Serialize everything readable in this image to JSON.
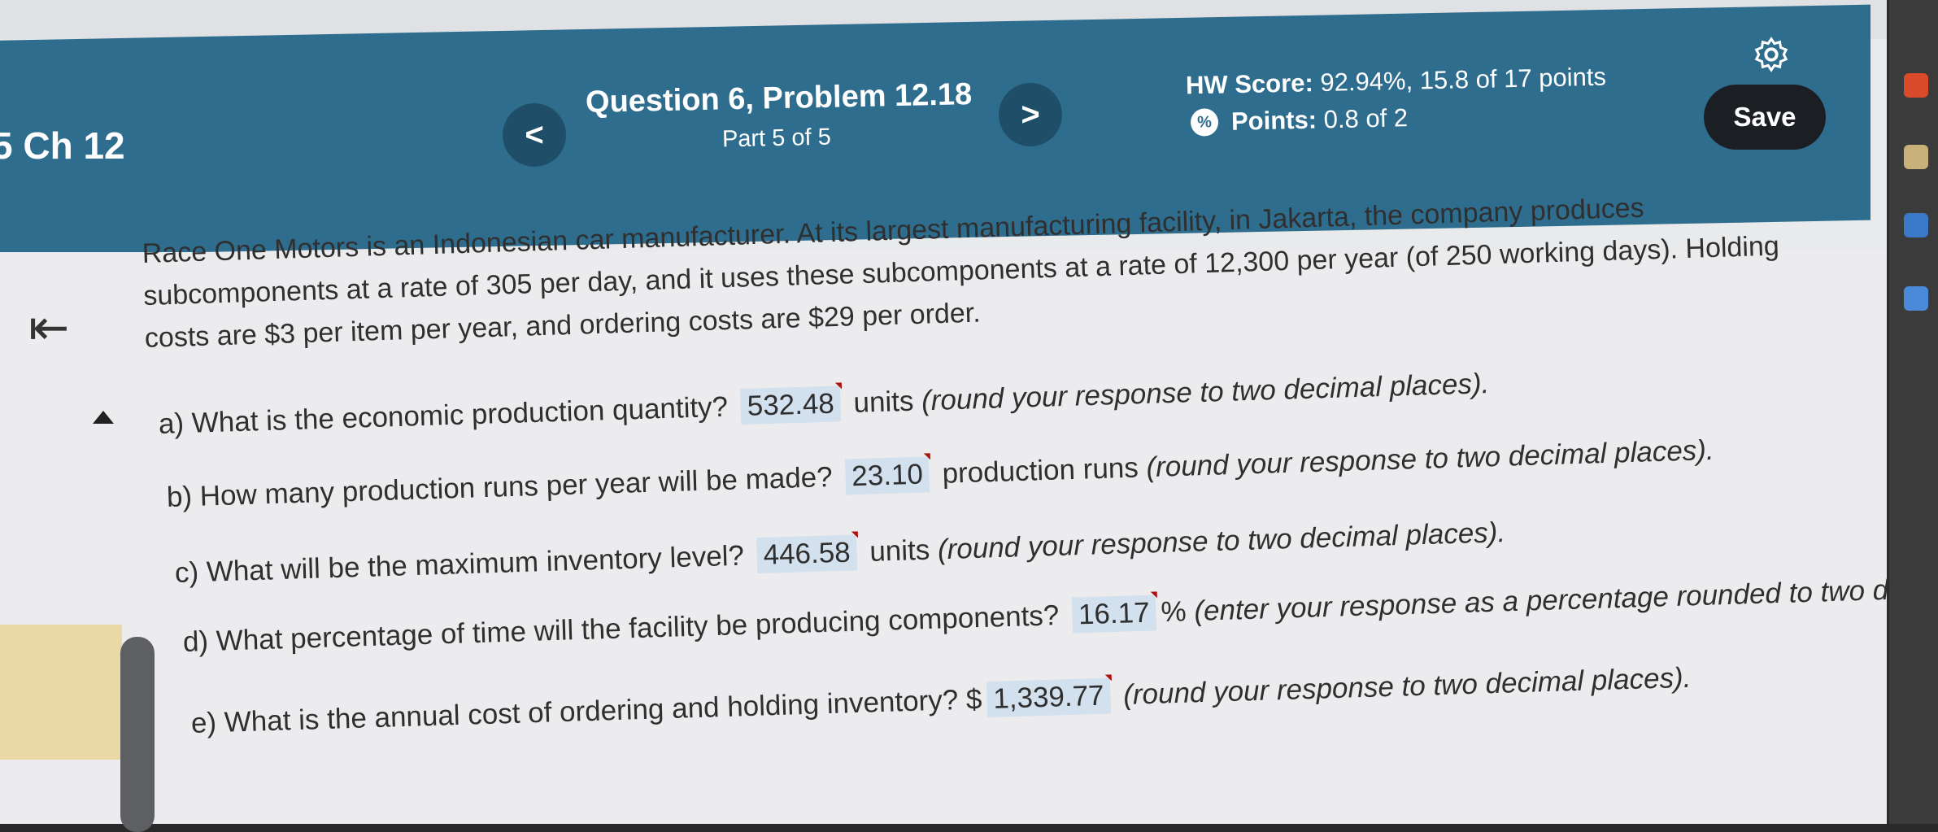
{
  "course": {
    "title": "5 Ch 12"
  },
  "question": {
    "title": "Question 6, Problem 12.18",
    "part": "Part 5 of 5",
    "prev_label": "<",
    "next_label": ">"
  },
  "score": {
    "hw_label": "HW Score:",
    "hw_value": "92.94%, 15.8 of 17 points",
    "points_label": "Points:",
    "points_value": "0.8 of 2"
  },
  "toolbar": {
    "save_label": "Save"
  },
  "problem_text": "Race One Motors is an Indonesian car manufacturer. At its largest manufacturing facility, in Jakarta, the company produces subcomponents at a rate of 305 per day, and it uses these subcomponents at a rate of 12,300 per year (of 250 working days). Holding costs are $3 per item per year, and ordering costs are $29 per order.",
  "parts": [
    {
      "prompt": "a) What is the economic production quantity?",
      "answer": "532.48",
      "after": "units",
      "note": "(round your response to two decimal places)."
    },
    {
      "prompt": "b) How many production runs per year will be made?",
      "answer": "23.10",
      "after": "production runs",
      "note": "(round your response to two decimal places)."
    },
    {
      "prompt": "c) What will be the maximum inventory level?",
      "answer": "446.58",
      "after": "units",
      "note": "(round your response to two decimal places)."
    },
    {
      "prompt": "d) What percentage of time will the facility be producing components?",
      "answer": "16.17",
      "after": "%",
      "note": "(enter your response as a percentage rounded to two decimal places)."
    },
    {
      "prompt": "e) What is the annual cost of ordering and holding inventory? $",
      "answer": "1,339.77",
      "after": "",
      "note": "(round your response to two decimal places)."
    }
  ],
  "icons": {
    "collapse": "collapse-left-icon",
    "gear": "gear-icon",
    "points": "partial-credit-icon",
    "expand": "triangle-up-icon"
  },
  "colors": {
    "header": "#2e6d8e",
    "answer_bg": "#d3e1ee",
    "save_bg": "#1b1f24"
  }
}
